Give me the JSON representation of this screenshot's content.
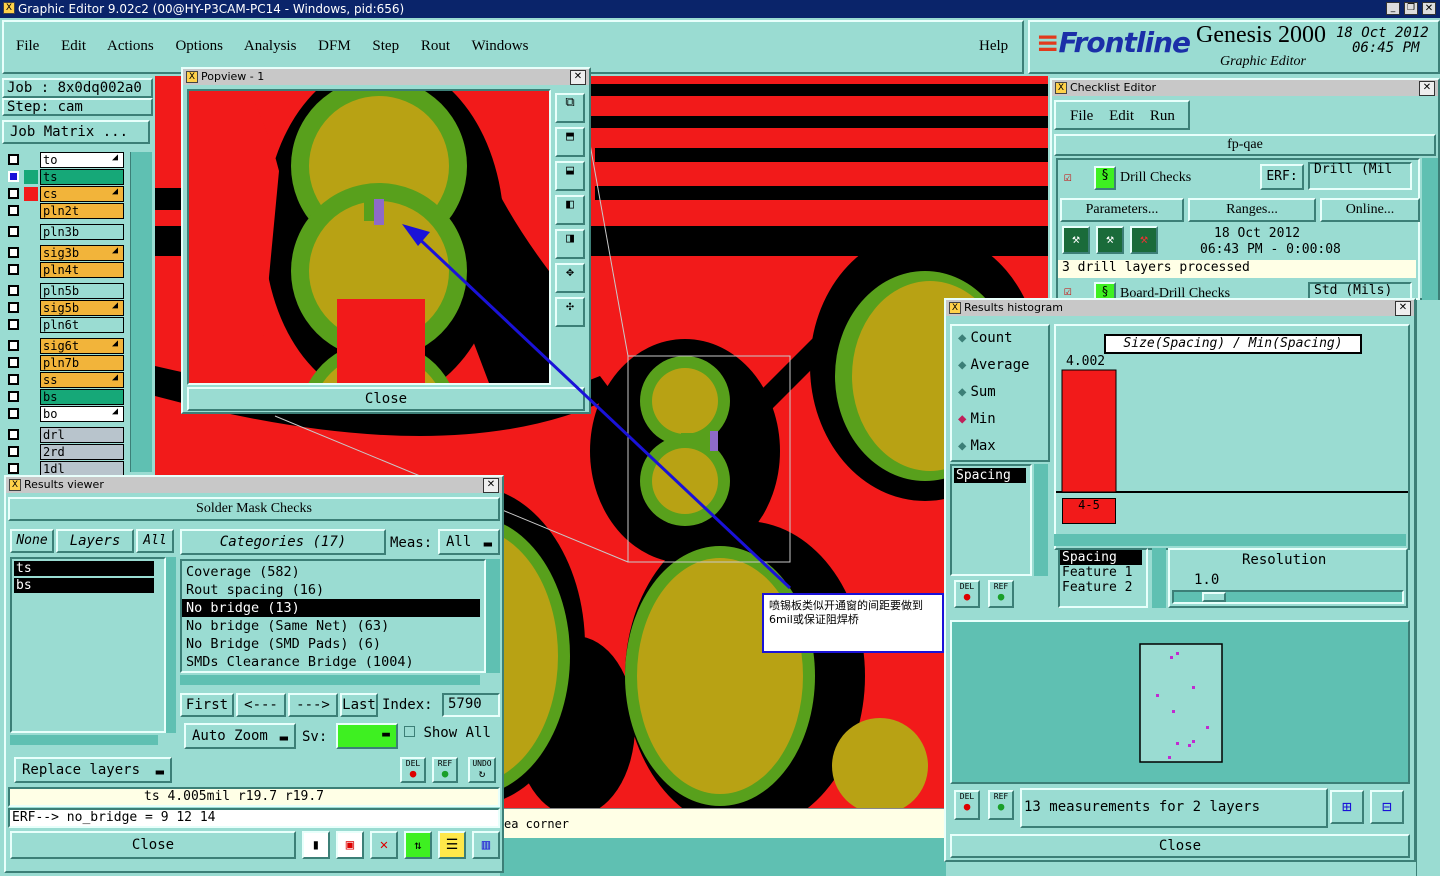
{
  "os_titlebar": {
    "title": "Graphic Editor 9.02c2 (00@HY-P3CAM-PC14 - Windows, pid:656)"
  },
  "menu": {
    "items": [
      "File",
      "Edit",
      "Actions",
      "Options",
      "Analysis",
      "DFM",
      "Step",
      "Rout",
      "Windows"
    ],
    "help": "Help"
  },
  "brand": {
    "logo": "Frontline",
    "product": "Genesis 2000",
    "subtitle": "Graphic Editor",
    "date": "18 Oct 2012",
    "time": "06:45 PM"
  },
  "job": {
    "job": "Job : 8x0dq002a0",
    "step": "Step: cam",
    "matrix_btn": "Job Matrix ..."
  },
  "layers": [
    {
      "name": "to",
      "color": "#ffffff",
      "arrow": true
    },
    {
      "name": "ts",
      "color": "#16a878",
      "arrow": false
    },
    {
      "name": "cs",
      "color": "#f2b43a",
      "arrow": true
    },
    {
      "name": "pln2t",
      "color": "#f2b43a",
      "arrow": false
    },
    {
      "name": "pln3b",
      "color": "#9adcd2",
      "arrow": false
    },
    {
      "name": "sig3b",
      "color": "#f2b43a",
      "arrow": true
    },
    {
      "name": "pln4t",
      "color": "#f2b43a",
      "arrow": false
    },
    {
      "name": "pln5b",
      "color": "#9adcd2",
      "arrow": false
    },
    {
      "name": "sig5b",
      "color": "#f2b43a",
      "arrow": true
    },
    {
      "name": "pln6t",
      "color": "#9adcd2",
      "arrow": false
    },
    {
      "name": "sig6t",
      "color": "#f2b43a",
      "arrow": true
    },
    {
      "name": "pln7b",
      "color": "#f2b43a",
      "arrow": false
    },
    {
      "name": "ss",
      "color": "#f2b43a",
      "arrow": true
    },
    {
      "name": "bs",
      "color": "#16a878",
      "arrow": false
    },
    {
      "name": "bo",
      "color": "#ffffff",
      "arrow": true
    },
    {
      "name": "drl",
      "color": "#b8c4cc",
      "arrow": false
    },
    {
      "name": "2rd",
      "color": "#b8c4cc",
      "arrow": false
    },
    {
      "name": "1dl",
      "color": "#b8c4cc",
      "arrow": false
    }
  ],
  "popview": {
    "title": "Popview - 1",
    "close": "Close"
  },
  "annotation": {
    "text": "喷锡板类似开通窗的间距要做到6mil或保证阻焊桥"
  },
  "results_viewer": {
    "title": "Results viewer",
    "header": "Solder Mask Checks",
    "none_btn": "None",
    "layers_btn": "Layers",
    "all_btn": "All",
    "layers": [
      "ts",
      "bs"
    ],
    "categories_btn": "Categories (17)",
    "meas_label": "Meas:",
    "meas_value": "All",
    "categories": [
      "Coverage (582)",
      "Rout spacing (16)",
      "No bridge (13)",
      "No bridge (Same Net) (63)",
      "No Bridge (SMD Pads) (6)",
      "SMDs Clearance Bridge (1004)"
    ],
    "selected_category": 2,
    "first": "First",
    "prev": "<---",
    "next": "--->",
    "last": "Last",
    "index_label": "Index:",
    "index_value": "5790",
    "auto_zoom": "Auto Zoom",
    "sv_label": "Sv:",
    "show_all": "Show All",
    "replace_layers": "Replace layers",
    "del": "DEL",
    "ref": "REF",
    "undo": "UNDO",
    "status": "ts 4.005mil   r19.7   r19.7",
    "erf": "ERF--> no_bridge = 9 12 14",
    "close": "Close"
  },
  "bottom_status": {
    "text": "ea corner"
  },
  "checklist": {
    "title": "Checklist Editor",
    "menu": [
      "File",
      "Edit",
      "Run"
    ],
    "name": "fp-qae",
    "drill_checks": "Drill Checks",
    "erf_label": "ERF:",
    "erf_value": "Drill (Mil",
    "parameters": "Parameters...",
    "ranges": "Ranges...",
    "online": "Online...",
    "run_date": "18 Oct 2012",
    "run_time": "06:43 PM - 0:00:08",
    "status": "3 drill layers processed",
    "board_drill": "Board-Drill Checks",
    "erf_value2": "Std (Mils)"
  },
  "histogram": {
    "title": "Results histogram",
    "options": [
      "Count",
      "Average",
      "Sum",
      "Min",
      "Max"
    ],
    "selected_option": 3,
    "chart_title": "Size(Spacing) / Min(Spacing)",
    "bar_value": "4.002",
    "bin_label": "4-5",
    "list_item": "Spacing",
    "resolution_label": "Resolution",
    "resolution_value": "1.0",
    "sort_list": [
      "Spacing",
      "Feature 1",
      "Feature 2"
    ],
    "del": "DEL",
    "ref": "REF",
    "summary": "13 measurements for 2 layers",
    "close": "Close"
  }
}
